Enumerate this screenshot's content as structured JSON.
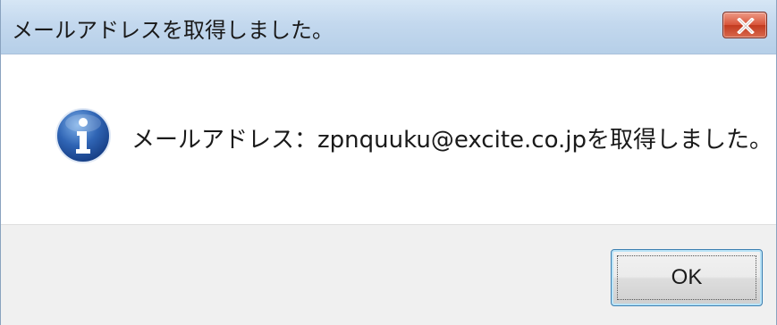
{
  "window": {
    "title": "メールアドレスを取得しました。"
  },
  "icons": {
    "info": "info-icon",
    "close": "close-icon"
  },
  "dialog": {
    "message": "メールアドレス：zpnquuku@excite.co.jpを取得しました。",
    "ok_label": "OK"
  },
  "colors": {
    "titlebar": "#c3d8ee",
    "close_button": "#d8553a",
    "footer": "#f0f0f0",
    "info_icon": "#2f64b4"
  }
}
